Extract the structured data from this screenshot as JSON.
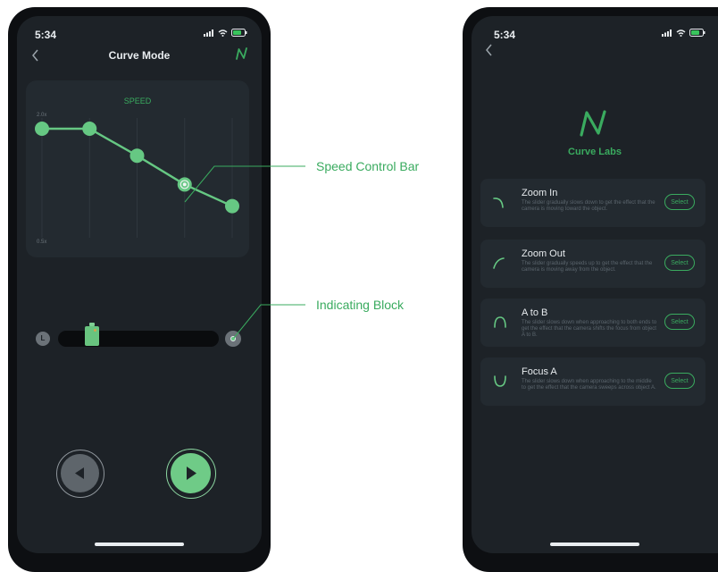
{
  "left_phone": {
    "status": {
      "time": "5:34"
    },
    "nav": {
      "title": "Curve Mode",
      "back_icon": "chevron-left-icon",
      "logo_icon": "curve-logo-icon"
    },
    "chart_data": {
      "type": "line",
      "title": "SPEED",
      "ymax_label": "2.0x",
      "ymin_label": "0.5x",
      "ylim": [
        0.5,
        2.0
      ],
      "x": [
        0,
        1,
        2,
        3,
        4
      ],
      "values": [
        2.0,
        2.0,
        1.7,
        1.38,
        1.14
      ],
      "selected_index": 3,
      "grid": "vertical",
      "line_color": "#66c883"
    },
    "slider": {
      "start_label": "L",
      "end_icon": "target-icon",
      "handle_icon": "camera-slider-handle-icon",
      "level": 0.18
    },
    "controls": {
      "back_icon": "play-reverse-icon",
      "play_icon": "play-icon"
    }
  },
  "callouts": {
    "speed_control": "Speed Control Bar",
    "indicating_block": "Indicating Block"
  },
  "right_phone": {
    "status": {
      "time": "5:34"
    },
    "nav": {
      "back_icon": "chevron-left-icon"
    },
    "brand": {
      "name": "Curve Labs",
      "logo_icon": "curve-logo-icon"
    },
    "curves": [
      {
        "name": "Zoom In",
        "icon": "zoom-in-curve-icon",
        "desc": "The slider gradually slows down to get the effect that the camera is moving toward the object.",
        "select": "Select"
      },
      {
        "name": "Zoom Out",
        "icon": "zoom-out-curve-icon",
        "desc": "The slider gradually speeds up to get the effect that the camera is moving away from the object.",
        "select": "Select"
      },
      {
        "name": "A to B",
        "icon": "a-to-b-curve-icon",
        "desc": "The slider slows down when approaching to both ends to get the effect that the camera shifts the focus from object A to B.",
        "select": "Select"
      },
      {
        "name": "Focus A",
        "icon": "focus-a-curve-icon",
        "desc": "The slider slows down when approaching to the middle to get the effect that the camera sweeps across object A.",
        "select": "Select"
      }
    ]
  },
  "colors": {
    "accent": "#3aab5f",
    "point": "#66c883",
    "background": "#1d2227",
    "card": "#232a30"
  }
}
